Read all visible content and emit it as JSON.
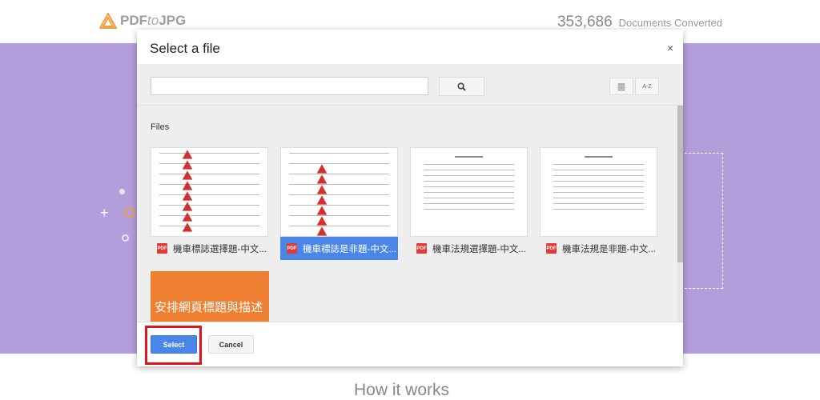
{
  "header": {
    "logo_main": "PDF",
    "logo_mid": "to",
    "logo_end": "JPG",
    "count": "353,686",
    "count_label": "Documents Converted"
  },
  "page": {
    "how_it_works": "How it works"
  },
  "dialog": {
    "title": "Select a file",
    "close": "×",
    "search_placeholder": "",
    "search_icon": "magnifier-icon",
    "list_icon": "≣",
    "sort_icon": "A-Z",
    "files_label": "Files",
    "files": [
      {
        "name": "機車標誌選擇題-中文...",
        "selected": false
      },
      {
        "name": "機車標誌是非題-中文...",
        "selected": true
      },
      {
        "name": "機車法規選擇題-中文...",
        "selected": false
      },
      {
        "name": "機車法規是非題-中文...",
        "selected": false
      }
    ],
    "orange_tile_text": "安排網頁標題與描述",
    "pdf_badge": "PDF",
    "select_label": "Select",
    "cancel_label": "Cancel"
  }
}
